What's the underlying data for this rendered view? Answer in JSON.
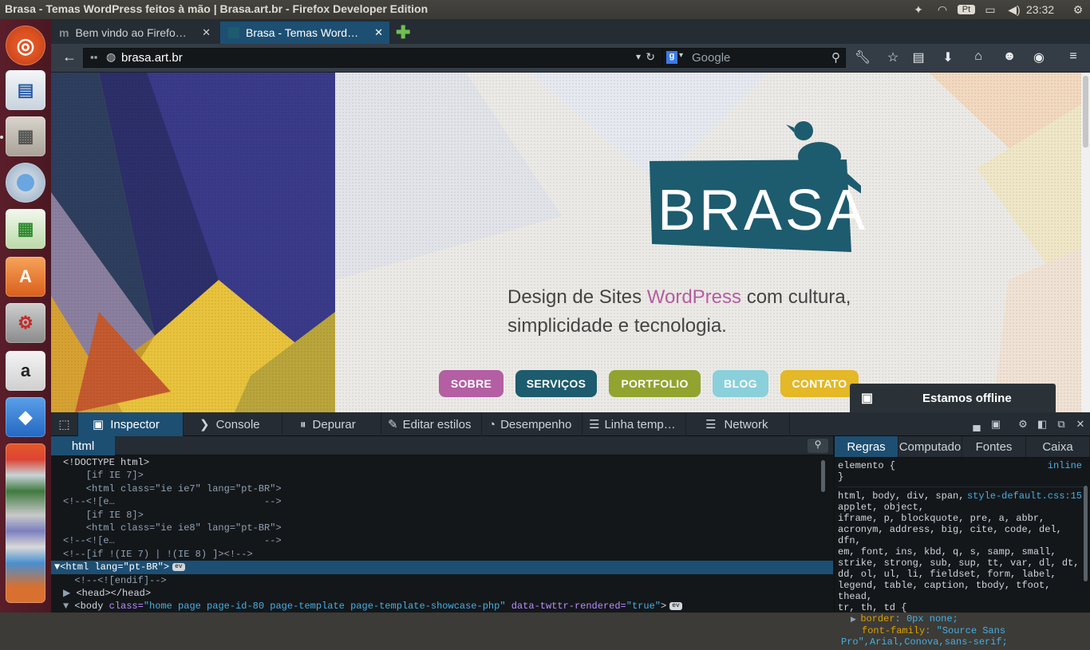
{
  "window_title": "Brasa - Temas WordPress feitos à mão | Brasa.art.br - Firefox Developer Edition",
  "tray": {
    "clock": "23:32",
    "keyboard": "Pt"
  },
  "tabs": [
    {
      "label": "Bem vindo ao Firefo…"
    },
    {
      "label": "Brasa - Temas Word…"
    }
  ],
  "url": "brasa.art.br",
  "search_placeholder": "Google",
  "site": {
    "logo": "BRASA",
    "tagline_1a": "Design de Sites ",
    "tagline_1b": "WordPress",
    "tagline_1c": " com cultura,",
    "tagline_2": "simplicidade e tecnologia.",
    "menu": [
      {
        "label": "SOBRE",
        "color": "#b45ea3"
      },
      {
        "label": "SERVIÇOS",
        "color": "#1d5b6e"
      },
      {
        "label": "PORTFOLIO",
        "color": "#93a32f"
      },
      {
        "label": "BLOG",
        "color": "#8ad0db"
      },
      {
        "label": "CONTATO",
        "color": "#e4b826"
      }
    ],
    "chat": "Estamos offline"
  },
  "devtools": {
    "tabs": [
      "Inspector",
      "Console",
      "Depurar",
      "Editar estilos",
      "Desempenho",
      "Linha temp…",
      "Network"
    ],
    "breadcrumb": "html",
    "markup": {
      "l1": "<!DOCTYPE html>",
      "l2": "    [if IE 7]>",
      "l3": "    <html class=\"ie ie7\" lang=\"pt-BR\">",
      "l4": "<!--<![e…                          -->",
      "l5": "    [if IE 8]>",
      "l6": "    <html class=\"ie ie8\" lang=\"pt-BR\">",
      "l7": "<!--<![e…                          -->",
      "l8": "<!--[if !(IE 7) | !(IE 8) ]><!-->",
      "l9_tag": "<html ",
      "l9_attr": "lang=",
      "l9_val": "\"pt-BR\"",
      "l9_end": ">",
      "l10": "  <!--<![endif]-->",
      "l11": "<head></head>",
      "l12_tag": "<body ",
      "l12_attr": "class=",
      "l12_val": "\"home page page-id-80 page-template page-template-showcase-php\"",
      "l12_attr2": " data-twttr-rendered=",
      "l12_val2": "\"true\"",
      "l12_end": ">",
      "ev": "ev"
    },
    "side_tabs": [
      "Regras",
      "Computado",
      "Fontes",
      "Caixa"
    ],
    "rules": {
      "el_selector": "elemento {",
      "el_src": "inline",
      "el_close": "}",
      "sel1": "html, body, div, span,",
      "src1": "style-default.css:15",
      "sel2": "applet, object,",
      "sel3": "iframe, p, blockquote, pre, a, abbr,",
      "sel4": "acronym, address, big, cite, code, del, dfn,",
      "sel5": "em, font, ins, kbd, q, s, samp, small,",
      "sel6": "strike, strong, sub, sup, tt, var, dl, dt,",
      "sel7": "dd, ol, ul, li, fieldset, form, label,",
      "sel8": "legend, table, caption, tbody, tfoot, thead,",
      "sel9": "tr, th, td {",
      "p1_name": "border",
      "p1_val": "0px none;",
      "p2_name": "font-family",
      "p2_val": "\"Source Sans",
      "p2_cont": "Pro\",Arial,Conova,sans-serif;"
    }
  }
}
